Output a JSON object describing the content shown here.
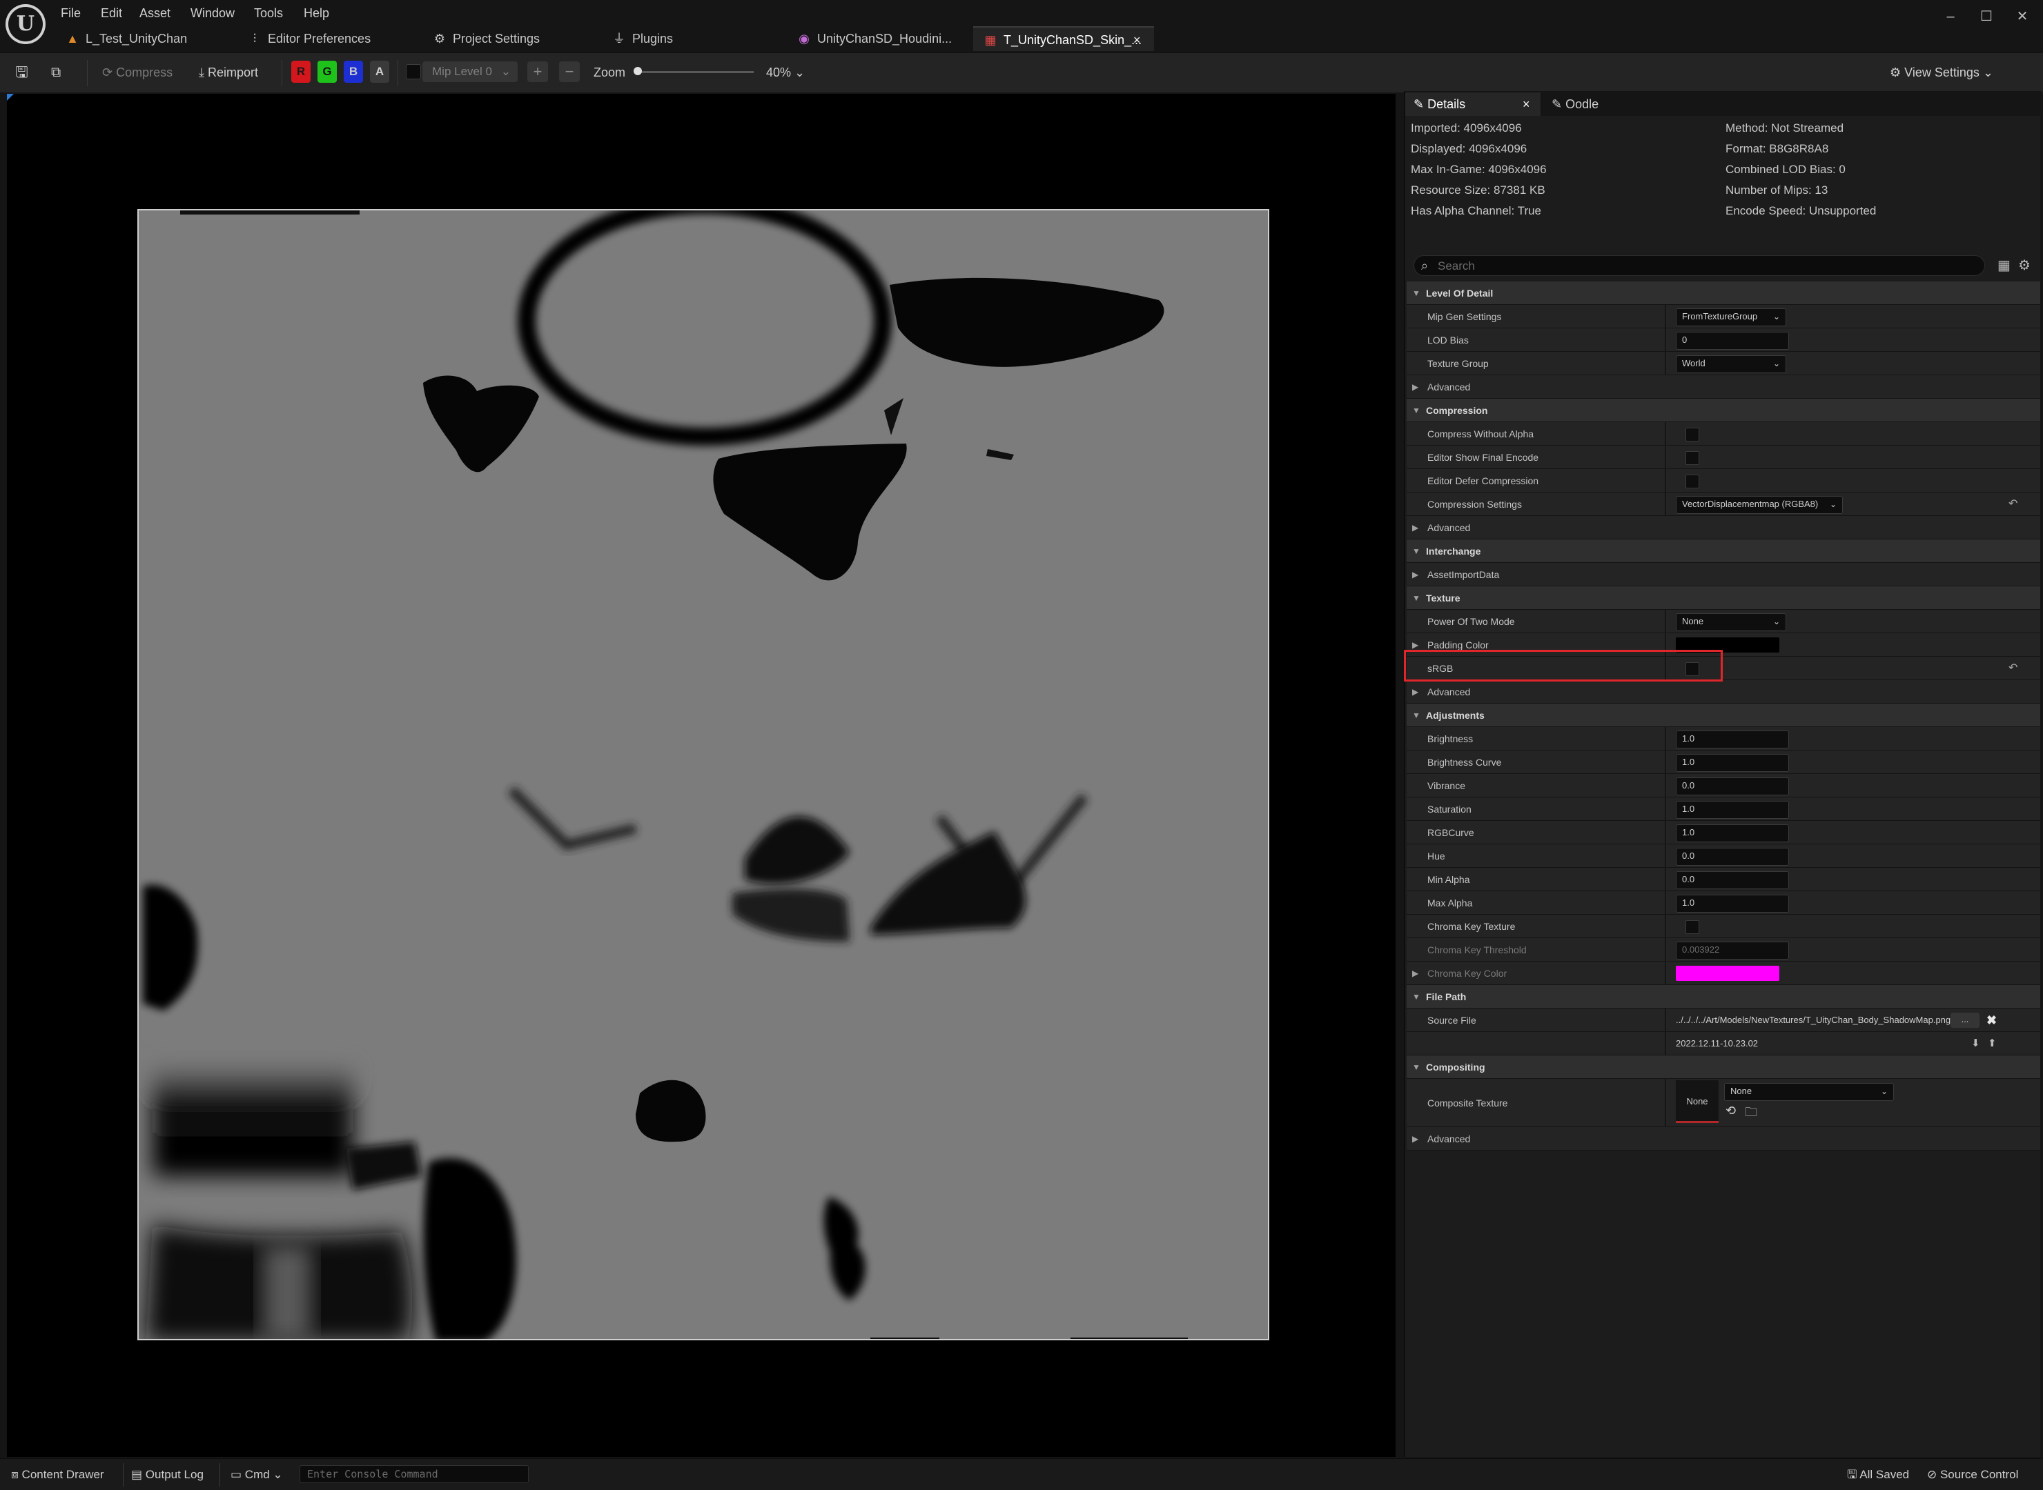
{
  "menu": [
    "File",
    "Edit",
    "Asset",
    "Window",
    "Tools",
    "Help"
  ],
  "tabs": [
    {
      "label": "L_Test_UnityChan",
      "icon": "level-icon"
    },
    {
      "label": "Editor Preferences",
      "icon": "sliders-icon"
    },
    {
      "label": "Project Settings",
      "icon": "gears-icon"
    },
    {
      "label": "Plugins",
      "icon": "plug-icon"
    },
    {
      "label": "UnityChanSD_Houdini...",
      "icon": "material-icon"
    },
    {
      "label": "T_UnityChanSD_Skin_...",
      "icon": "texture-icon"
    }
  ],
  "toolbar": {
    "compress": "Compress",
    "reimport": "Reimport",
    "channels": [
      "R",
      "G",
      "B",
      "A"
    ],
    "mip_level": "Mip Level 0",
    "zoom_label": "Zoom",
    "zoom_value": "40%",
    "view_settings": "View Settings"
  },
  "panel": {
    "tabs": [
      "Details",
      "Oodle"
    ],
    "info_left": [
      "Imported: 4096x4096",
      "Displayed: 4096x4096",
      "Max In-Game: 4096x4096",
      "Resource Size: 87381 KB",
      "Has Alpha Channel: True"
    ],
    "info_right": [
      "Method: Not Streamed",
      "Format: B8G8R8A8",
      "Combined LOD Bias: 0",
      "Number of Mips: 13",
      "Encode Speed: Unsupported"
    ],
    "search_placeholder": "Search",
    "sections": {
      "lod": "Level Of Detail",
      "mip_gen_settings": "Mip Gen Settings",
      "mip_gen_value": "FromTextureGroup",
      "lod_bias": "LOD Bias",
      "lod_bias_value": "0",
      "texture_group": "Texture Group",
      "texture_group_value": "World",
      "advanced": "Advanced",
      "compression": "Compression",
      "compress_without_alpha": "Compress Without Alpha",
      "editor_show_final_encode": "Editor Show Final Encode",
      "editor_defer_compression": "Editor Defer Compression",
      "compression_settings": "Compression Settings",
      "compression_settings_value": "VectorDisplacementmap (RGBA8)",
      "interchange": "Interchange",
      "asset_import_data": "AssetImportData",
      "texture": "Texture",
      "power_of_two_mode": "Power Of Two Mode",
      "power_of_two_value": "None",
      "padding_color": "Padding Color",
      "srgb": "sRGB",
      "adjustments": "Adjustments",
      "brightness": "Brightness",
      "brightness_value": "1.0",
      "brightness_curve": "Brightness Curve",
      "brightness_curve_value": "1.0",
      "vibrance": "Vibrance",
      "vibrance_value": "0.0",
      "saturation": "Saturation",
      "saturation_value": "1.0",
      "rgbcurve": "RGBCurve",
      "rgbcurve_value": "1.0",
      "hue": "Hue",
      "hue_value": "0.0",
      "min_alpha": "Min Alpha",
      "min_alpha_value": "0.0",
      "max_alpha": "Max Alpha",
      "max_alpha_value": "1.0",
      "chroma_key_texture": "Chroma Key Texture",
      "chroma_key_threshold": "Chroma Key Threshold",
      "chroma_key_threshold_value": "0.003922",
      "chroma_key_color": "Chroma Key Color",
      "file_path": "File Path",
      "source_file": "Source File",
      "source_file_value": "../../../../Art/Models/NewTextures/T_UityChan_Body_ShadowMap.png",
      "source_file_browse": "...",
      "timestamp": "2022.12.11-10.23.02",
      "compositing": "Compositing",
      "composite_texture": "Composite Texture",
      "composite_thumb": "None",
      "composite_value": "None"
    }
  },
  "colors": {
    "padding_color": "#000000",
    "chroma_key_color": "#ff00ff",
    "highlight": "#e0262a"
  },
  "status": {
    "content_drawer": "Content Drawer",
    "output_log": "Output Log",
    "cmd": "Cmd",
    "console_placeholder": "Enter Console Command",
    "all_saved": "All Saved",
    "source_control": "Source Control"
  }
}
